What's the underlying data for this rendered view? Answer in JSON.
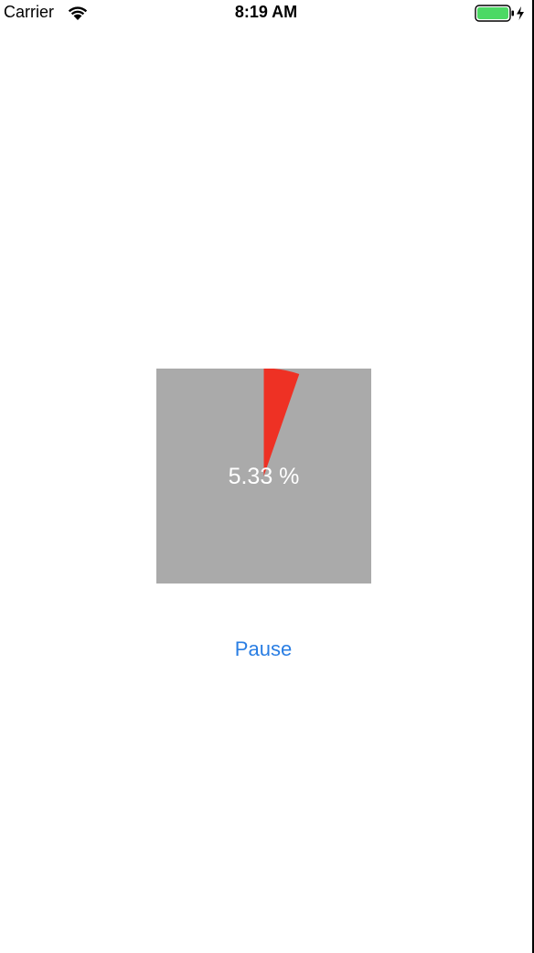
{
  "status_bar": {
    "carrier": "Carrier",
    "time": "8:19 AM",
    "wifi_icon": "wifi-icon",
    "battery_icon": "battery-charging-icon",
    "battery_color": "#4cd964"
  },
  "progress": {
    "percent": 5.33,
    "label": "5.33 %",
    "fill_color": "#ee3124",
    "background_color": "#aaaaaa"
  },
  "controls": {
    "pause_label": "Pause",
    "accent_color": "#2a7ee3"
  }
}
